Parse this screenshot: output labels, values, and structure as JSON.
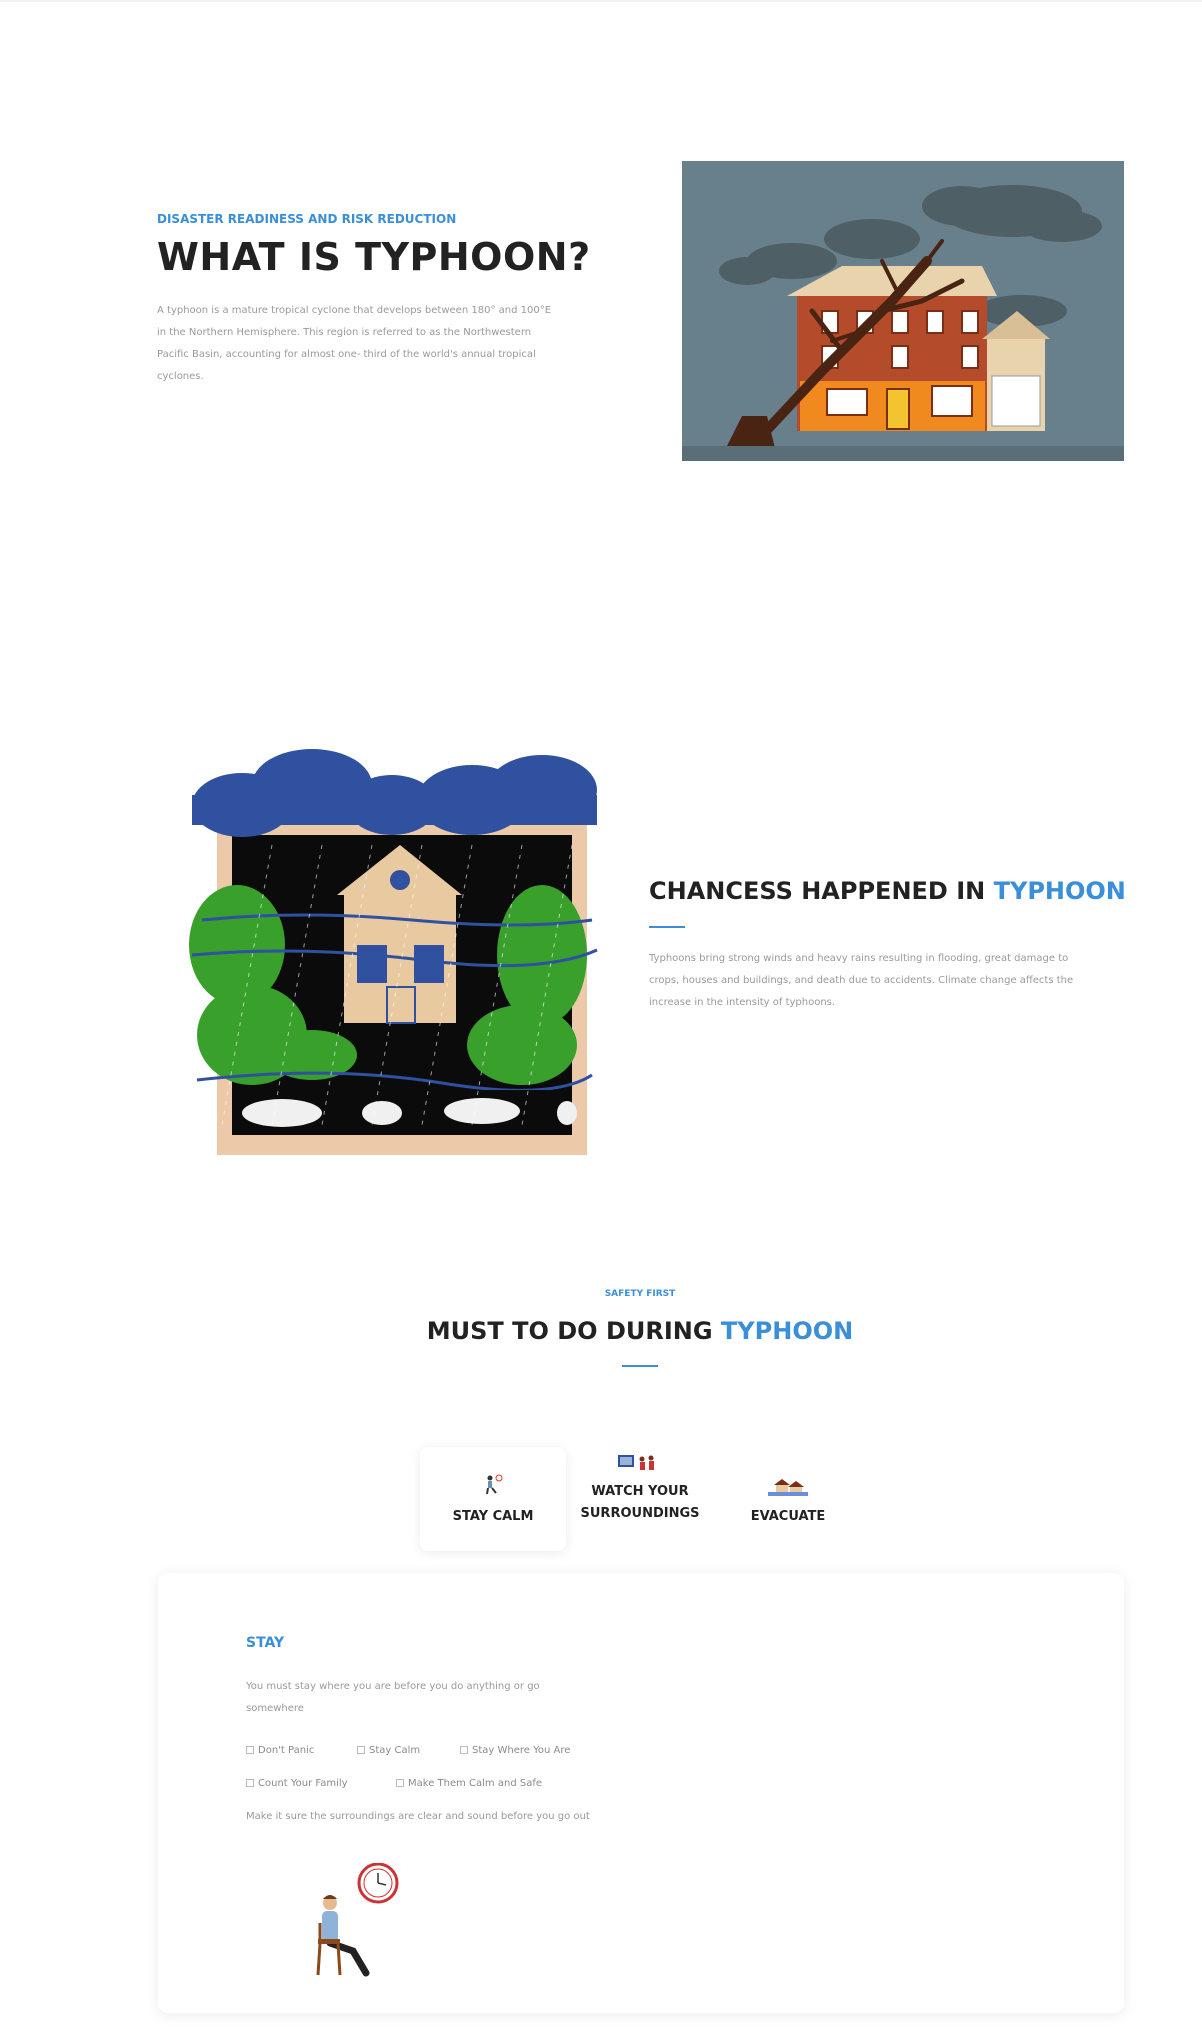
{
  "section_intro": {
    "eyebrow": "DISASTER READINESS AND RISK REDUCTION",
    "title": "WHAT IS TYPHOON?",
    "paragraph_lines": [
      "A typhoon is a mature tropical cyclone that develops between 180° and 100°E",
      "in the Northern Hemisphere. This region is referred to as the Northwestern",
      "Pacific Basin, accounting for almost one- third of the world's annual tropical",
      "cyclones."
    ],
    "image_icon": "storm-house-illustration"
  },
  "section_chances": {
    "title_main": "CHANCESS HAPPENED IN ",
    "title_accent": "TYPHOON",
    "paragraph_lines": [
      "Typhoons bring strong winds and heavy rains resulting in flooding, great damage to",
      "crops, houses and buildings, and death due to accidents. Climate change affects the",
      "increase in the intensity of typhoons."
    ],
    "image_icon": "flooded-house-illustration"
  },
  "section_safety": {
    "eyebrow": "SAFETY FIRST",
    "title_main": "MUST TO DO DURING ",
    "title_accent": "TYPHOON",
    "tabs": [
      {
        "label": "STAY CALM",
        "icon": "sitting-person-icon"
      },
      {
        "label_line1": "WATCH YOUR",
        "label_line2": "SURROUNDINGS",
        "icon": "tv-family-icon"
      },
      {
        "label": "EVACUATE",
        "icon": "flooded-house-icon"
      }
    ],
    "panel": {
      "title": "STAY",
      "description_lines": [
        "You must stay where you are before you do anything or go",
        "somewhere"
      ],
      "checklist": [
        "Don't Panic",
        "Stay Calm",
        "Stay Where You Are",
        "Count Your Family",
        "Make Them Calm and Safe"
      ],
      "note": "Make it sure the surroundings are clear and sound before you go out",
      "illustration_icon": "person-waiting-clock-icon"
    }
  },
  "colors": {
    "accent": "#3a8fd8",
    "heading": "#222222",
    "body_text": "#9a9a9a"
  }
}
